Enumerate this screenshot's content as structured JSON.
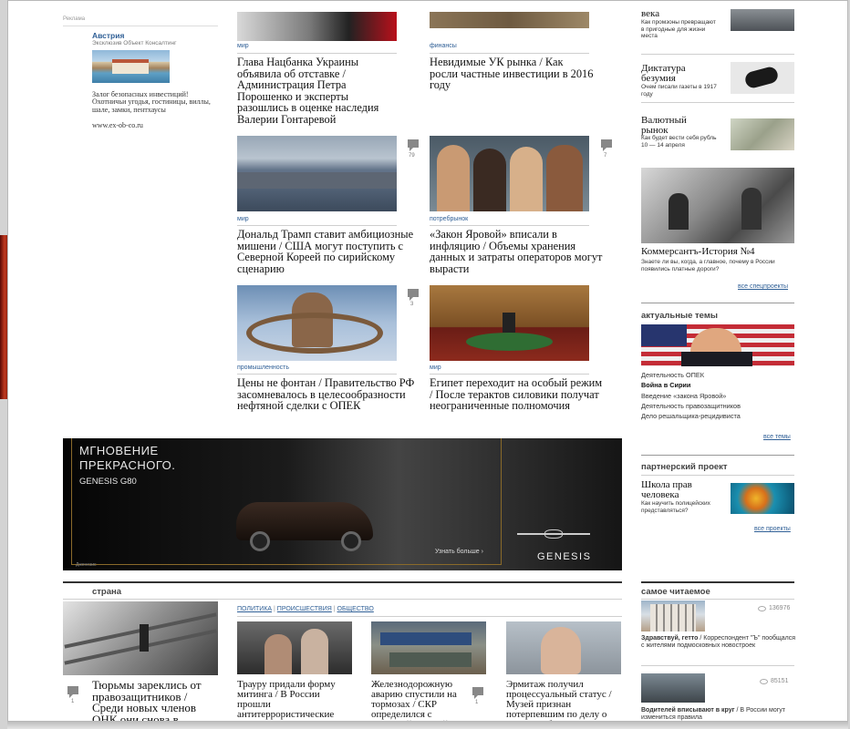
{
  "left_ad": {
    "label": "Реклама",
    "title": "Австрия",
    "subtitle": "Эксклюзив Объект Консалтинг",
    "text": "Залог безопасных инвестиций! Охотничьи угодья, гостиницы, виллы, шале, замки, пентхаусы",
    "url": "www.ex-ob-co.ru"
  },
  "articles": [
    {
      "rubric": "мир",
      "head": "Глава Нацбанка Украины объявила об отставке",
      "sub": " / Администрация Петра Порошенко и эксперты разошлись в оценке наследия Валерии Гонтаревой"
    },
    {
      "rubric": "финансы",
      "head": "Невидимые УК рынка",
      "sub": " / Как росли частные инвестиции в 2016 году"
    },
    {
      "rubric": "мир",
      "head": "Дональд Трамп ставит амбициозные мишени",
      "sub": " / США могут поступить с Северной Кореей по сирийскому сценарию",
      "comments": "79"
    },
    {
      "rubric": "потребрынок",
      "head": "«Закон Яровой» вписали в инфляцию",
      "sub": " / Объемы хранения данных и затраты операторов могут вырасти",
      "comments": "7"
    },
    {
      "rubric": "промышленность",
      "head": "Цены не фонтан",
      "sub": " / Правительство РФ засомневалось в целесообразности нефтяной сделки с ОПЕК",
      "comments": "3"
    },
    {
      "rubric": "мир",
      "head": "Египет переходит на особый режим",
      "sub": " / После терактов силовики получат неограниченные полномочия"
    }
  ],
  "banner": {
    "line1": "МГНОВЕНИЕ",
    "line2": "ПРЕКРАСНОГО.",
    "model": "GENESIS G80",
    "cta": "Узнать больше ›",
    "brand": "GENESIS",
    "small": "Дженезис"
  },
  "country": {
    "heading": "страна",
    "main_title": "Тюрьмы зареклись от правозащитников",
    "main_sub": " / Среди новых членов ОНК они снова в",
    "main_comments": "1",
    "tags": [
      "ПОЛИТИКА",
      "ПРОИСШЕСТВИЯ",
      "ОБЩЕСТВО"
    ],
    "items": [
      {
        "head": "Траурy придали форму митинга",
        "sub": " / В России прошли антитеррористические акции"
      },
      {
        "head": "Железнодорожную аварию спустили на тормозах",
        "sub": " / СКР определился с основной версией столкновения",
        "comments": "1"
      },
      {
        "head": "Эрмитаж получил процессуальный статус",
        "sub": " / Музей признан потерпевшим по делу о хищении бюджетных"
      }
    ]
  },
  "right": {
    "top": [
      {
        "title": "века",
        "sub": "Как промзоны превращают в пригодные для жизни места"
      },
      {
        "title": "Диктатура безумия",
        "sub": "Очем писали газеты в 1917 году"
      },
      {
        "title": "Валютный рынок",
        "sub": "Как будет вести себя рубль 10 — 14 апреля"
      }
    ],
    "history_title": "Коммерсантъ-История №4",
    "history_sub": "Знаете ли вы, когда, а главное, почему в России появились платные дороги?",
    "all_special": "все спецпроекты",
    "topics_heading": "актуальные темы",
    "topics": [
      "Деятельность ОПЕК",
      "Война в Сирии",
      "Введение «закона Яровой»",
      "Деятельность правозащитников",
      "Дело решальщика-рецидивиста"
    ],
    "all_topics": "все темы",
    "partner_heading": "партнерский проект",
    "partner_title": "Школа прав человека",
    "partner_sub": "Как научить полицейских представляться?",
    "all_projects": "все проекты",
    "most_read_heading": "самое читаемое",
    "most_read": [
      {
        "views": "136976",
        "head": "Здравствуй, гетто",
        "sub": " / Корреспондент \"Ъ\" пообщался с жителями подмосковных новостроек"
      },
      {
        "views": "85151",
        "head": "Водителей вписывают в круг",
        "sub": " / В России могут измениться правила"
      }
    ]
  },
  "colors": {
    "link": "#2f5f96",
    "banner_bg": "#0b0b0b",
    "rule": "#cfcfcf"
  }
}
